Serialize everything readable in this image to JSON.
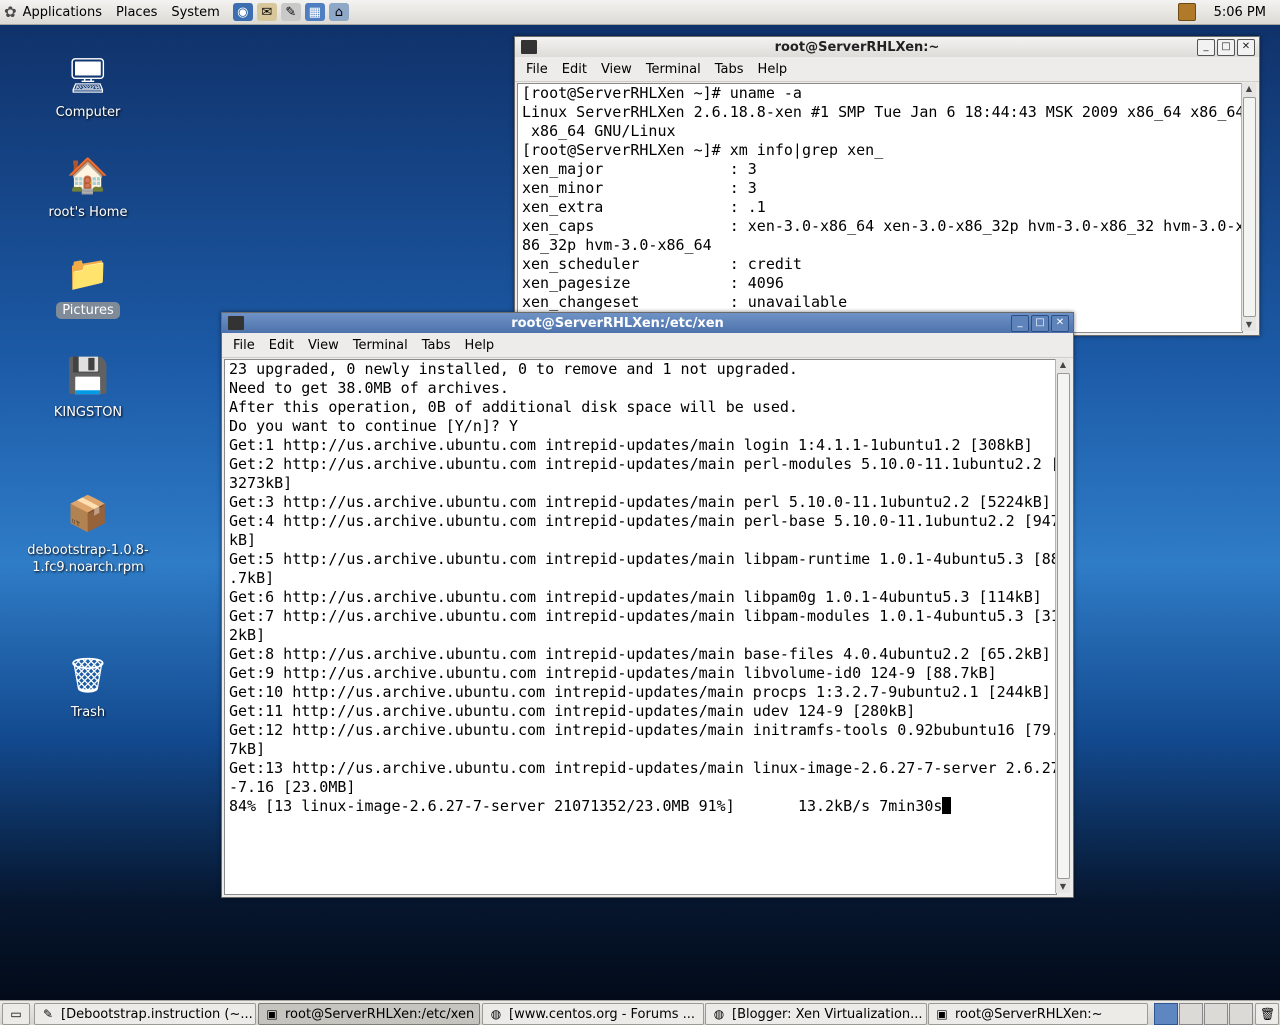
{
  "top_panel": {
    "menus": [
      "Applications",
      "Places",
      "System"
    ],
    "launchers": [
      "web-browser-icon",
      "mail-icon",
      "text-editor-icon",
      "calendar-icon",
      "network-icon"
    ],
    "clock": "5:06 PM"
  },
  "desktop_icons": [
    {
      "label": "Computer",
      "icon": "computer-icon"
    },
    {
      "label": "root's Home",
      "icon": "home-folder-icon"
    },
    {
      "label": "Pictures",
      "icon": "folder-icon",
      "selected": true
    },
    {
      "label": "KINGSTON",
      "icon": "usb-drive-icon"
    },
    {
      "label": "debootstrap-1.0.8-1.fc9.noarch.rpm",
      "icon": "package-icon"
    },
    {
      "label": "Trash",
      "icon": "trash-icon"
    }
  ],
  "windows": {
    "back": {
      "title": "root@ServerRHLXen:~",
      "menu": [
        "File",
        "Edit",
        "View",
        "Terminal",
        "Tabs",
        "Help"
      ],
      "lines": [
        "[root@ServerRHLXen ~]# uname -a",
        "Linux ServerRHLXen 2.6.18.8-xen #1 SMP Tue Jan 6 18:44:43 MSK 2009 x86_64 x86_64",
        " x86_64 GNU/Linux",
        "[root@ServerRHLXen ~]# xm info|grep xen_",
        "xen_major              : 3",
        "xen_minor              : 3",
        "xen_extra              : .1",
        "xen_caps               : xen-3.0-x86_64 xen-3.0-x86_32p hvm-3.0-x86_32 hvm-3.0-x",
        "86_32p hvm-3.0-x86_64",
        "xen_scheduler          : credit",
        "xen_pagesize           : 4096",
        "xen_changeset          : unavailable"
      ]
    },
    "front": {
      "title": "root@ServerRHLXen:/etc/xen",
      "menu": [
        "File",
        "Edit",
        "View",
        "Terminal",
        "Tabs",
        "Help"
      ],
      "lines": [
        "23 upgraded, 0 newly installed, 0 to remove and 1 not upgraded.",
        "Need to get 38.0MB of archives.",
        "After this operation, 0B of additional disk space will be used.",
        "Do you want to continue [Y/n]? Y",
        "Get:1 http://us.archive.ubuntu.com intrepid-updates/main login 1:4.1.1-1ubuntu1.2 [308kB]",
        "Get:2 http://us.archive.ubuntu.com intrepid-updates/main perl-modules 5.10.0-11.1ubuntu2.2 [",
        "3273kB]",
        "Get:3 http://us.archive.ubuntu.com intrepid-updates/main perl 5.10.0-11.1ubuntu2.2 [5224kB]",
        "Get:4 http://us.archive.ubuntu.com intrepid-updates/main perl-base 5.10.0-11.1ubuntu2.2 [947",
        "kB]",
        "Get:5 http://us.archive.ubuntu.com intrepid-updates/main libpam-runtime 1.0.1-4ubuntu5.3 [88",
        ".7kB]",
        "Get:6 http://us.archive.ubuntu.com intrepid-updates/main libpam0g 1.0.1-4ubuntu5.3 [114kB]",
        "Get:7 http://us.archive.ubuntu.com intrepid-updates/main libpam-modules 1.0.1-4ubuntu5.3 [31",
        "2kB]",
        "Get:8 http://us.archive.ubuntu.com intrepid-updates/main base-files 4.0.4ubuntu2.2 [65.2kB]",
        "Get:9 http://us.archive.ubuntu.com intrepid-updates/main libvolume-id0 124-9 [88.7kB]",
        "Get:10 http://us.archive.ubuntu.com intrepid-updates/main procps 1:3.2.7-9ubuntu2.1 [244kB]",
        "Get:11 http://us.archive.ubuntu.com intrepid-updates/main udev 124-9 [280kB]",
        "Get:12 http://us.archive.ubuntu.com intrepid-updates/main initramfs-tools 0.92bubuntu16 [79.",
        "7kB]",
        "Get:13 http://us.archive.ubuntu.com intrepid-updates/main linux-image-2.6.27-7-server 2.6.27",
        "-7.16 [23.0MB]"
      ],
      "progress_line": "84% [13 linux-image-2.6.27-7-server 21071352/23.0MB 91%]       13.2kB/s 7min30s"
    }
  },
  "taskbar": {
    "items": [
      {
        "label": "[Debootstrap.instruction (~...",
        "icon": "text-editor-icon",
        "pressed": false
      },
      {
        "label": "root@ServerRHLXen:/etc/xen",
        "icon": "terminal-icon",
        "pressed": true
      },
      {
        "label": "[www.centos.org - Forums ...",
        "icon": "firefox-icon",
        "pressed": false
      },
      {
        "label": "[Blogger: Xen Virtualization...",
        "icon": "firefox-icon",
        "pressed": false
      },
      {
        "label": "root@ServerRHLXen:~",
        "icon": "terminal-icon",
        "pressed": false
      }
    ]
  }
}
